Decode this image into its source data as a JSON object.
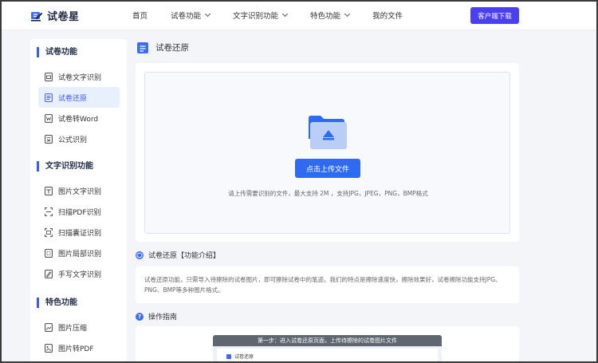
{
  "brand": {
    "name": "试卷星",
    "accent": "#3b5bf5",
    "button_color": "#4b3ff2"
  },
  "nav": {
    "items": [
      {
        "label": "首页",
        "has_dropdown": false
      },
      {
        "label": "试卷功能",
        "has_dropdown": true
      },
      {
        "label": "文字识别功能",
        "has_dropdown": true
      },
      {
        "label": "特色功能",
        "has_dropdown": true
      },
      {
        "label": "我的文件",
        "has_dropdown": false
      }
    ],
    "download_label": "客户端下载"
  },
  "sidebar": {
    "sections": [
      {
        "title": "试卷功能",
        "items": [
          "试卷文字识别",
          "试卷还原",
          "试卷转Word",
          "公式识别"
        ]
      },
      {
        "title": "文字识别功能",
        "items": [
          "图片文字识别",
          "扫描PDF识别",
          "扫描囊证识别",
          "图片局部识别",
          "手写文字识别"
        ]
      },
      {
        "title": "特色功能",
        "items": [
          "图片压缩",
          "图片转PDF"
        ]
      }
    ],
    "active_item": "试卷还原"
  },
  "main": {
    "title": "试卷还原",
    "upload": {
      "button_label": "点击上传文件",
      "hint": "请上传需要识别的文件，最大支持 2M ，支持JPG，JPEG，PNG，BMP格式"
    },
    "intro": {
      "heading": "试卷还原【功能介绍】",
      "body": "试卷还原功能，只需导入待擦除的试卷图片，即可擦除试卷中的笔迹。我们的特点是擦除速度快，擦除效果好，试卷擦除功能支持JPG、PNG、BMP等多种图片格式。"
    },
    "guide": {
      "heading": "操作指南",
      "step1": "第一步：进入试卷还原页面，上传待擦除的试卷图片文件",
      "inner_label": "试卷还原"
    }
  }
}
